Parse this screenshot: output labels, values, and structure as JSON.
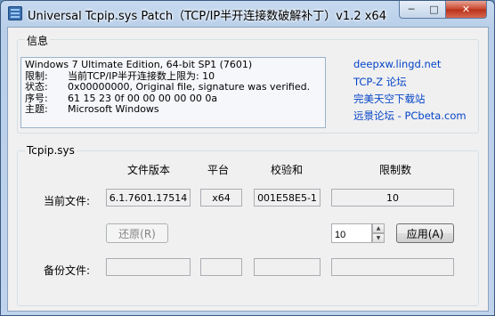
{
  "window": {
    "title": "Universal Tcpip.sys Patch（TCP/IP半开连接数破解补丁）v1.2 x64",
    "minimize": "─",
    "maximize": "□",
    "close": "✕"
  },
  "info": {
    "group_title": "信息",
    "os_line": "Windows 7 Ultimate Edition, 64-bit SP1 (7601)",
    "rows": [
      {
        "key": "限制:",
        "value": "当前TCP/IP半开连接数上限为:   10"
      },
      {
        "key": "状态:",
        "value": "0x00000000, Original file, signature was verified."
      },
      {
        "key": "序号:",
        "value": "61 15 23 0f 00 00 00 00 00 0a"
      },
      {
        "key": "主题:",
        "value": "Microsoft Windows"
      }
    ],
    "links": [
      "deepxw.lingd.net",
      "TCP-Z 论坛",
      "完美天空下载站",
      "远景论坛 - PCbeta.com"
    ]
  },
  "tcpip": {
    "group_title": "Tcpip.sys",
    "headers": {
      "version": "文件版本",
      "platform": "平台",
      "checksum": "校验和",
      "limit": "限制数"
    },
    "current": {
      "label": "当前文件:",
      "version": "6.1.7601.17514",
      "platform": "x64",
      "checksum": "001E58E5-1",
      "limit": "10"
    },
    "restore_label": "还原(R)",
    "spin_value": "10",
    "apply_label": "应用(A)",
    "backup": {
      "label": "备份文件:",
      "version": "",
      "platform": "",
      "checksum": "",
      "limit": ""
    }
  }
}
